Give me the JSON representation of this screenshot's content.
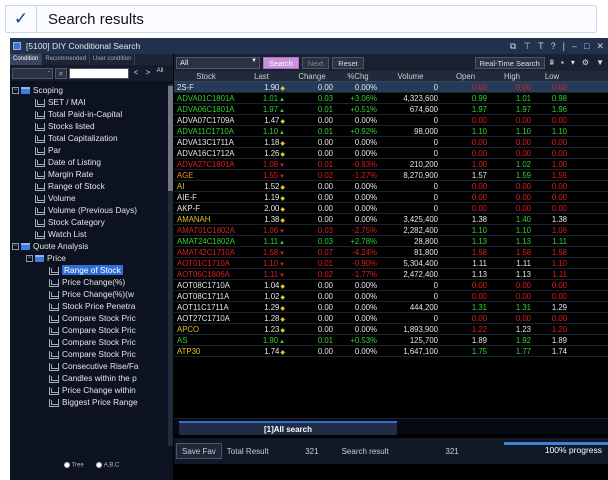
{
  "header": {
    "check": "✓",
    "title": "Search results"
  },
  "window": {
    "title": "[5100] DIY Conditional Search",
    "controls": [
      "⧉",
      "⊤",
      "T",
      "?",
      "|",
      "–",
      "□",
      "✕"
    ]
  },
  "left": {
    "tabs": [
      "Condition",
      "Recommended",
      "User condition"
    ],
    "filter_label": "-",
    "search_icon": "⌕",
    "nav_prev": "<",
    "nav_next": ">",
    "nav_all": "All",
    "tree": [
      {
        "label": "Scoping",
        "level": 0,
        "type": "folder",
        "expand": "−"
      },
      {
        "label": "SET / MAI",
        "level": 1,
        "type": "doc"
      },
      {
        "label": "Total Paid-in-Capital",
        "level": 1,
        "type": "doc"
      },
      {
        "label": "Stocks listed",
        "level": 1,
        "type": "doc"
      },
      {
        "label": "Total Capitalization",
        "level": 1,
        "type": "doc"
      },
      {
        "label": "Par",
        "level": 1,
        "type": "doc"
      },
      {
        "label": "Date of Listing",
        "level": 1,
        "type": "doc"
      },
      {
        "label": "Margin Rate",
        "level": 1,
        "type": "doc"
      },
      {
        "label": "Range of Stock",
        "level": 1,
        "type": "doc"
      },
      {
        "label": "Volume",
        "level": 1,
        "type": "doc"
      },
      {
        "label": "Volume (Previous Days)",
        "level": 1,
        "type": "doc"
      },
      {
        "label": "Stock Category",
        "level": 1,
        "type": "doc"
      },
      {
        "label": "Watch List",
        "level": 1,
        "type": "doc"
      },
      {
        "label": "Quote Analysis",
        "level": 0,
        "type": "folder",
        "expand": "−"
      },
      {
        "label": "Price",
        "level": 1,
        "type": "folder",
        "expand": "−"
      },
      {
        "label": "Range of Stock",
        "level": 2,
        "type": "doc",
        "selected": true
      },
      {
        "label": "Price Change(%)",
        "level": 2,
        "type": "doc"
      },
      {
        "label": "Price Change(%)(w",
        "level": 2,
        "type": "doc"
      },
      {
        "label": "Stock Price Penetra",
        "level": 2,
        "type": "doc"
      },
      {
        "label": "Compare Stock Pric",
        "level": 2,
        "type": "doc"
      },
      {
        "label": "Compare Stock Pric",
        "level": 2,
        "type": "doc"
      },
      {
        "label": "Compare Stock Pric",
        "level": 2,
        "type": "doc"
      },
      {
        "label": "Compare Stock Pric",
        "level": 2,
        "type": "doc"
      },
      {
        "label": "Consecutive Rise/Fa",
        "level": 2,
        "type": "doc"
      },
      {
        "label": "Candles within the p",
        "level": 2,
        "type": "doc"
      },
      {
        "label": "Price Change within",
        "level": 2,
        "type": "doc"
      },
      {
        "label": "Biggest Price Range",
        "level": 2,
        "type": "doc"
      }
    ],
    "footer": {
      "opt1": "Tree",
      "opt2": "A,B,C"
    }
  },
  "toolbar": {
    "filter": "All",
    "search": "Search",
    "next": "Next",
    "reset": "Reset",
    "realtime": "Real-Time Search",
    "icons": [
      "⩩",
      "▪",
      "▾",
      "⚙",
      "▼"
    ]
  },
  "columns": [
    "Stock",
    "Last",
    "Change",
    "%Chg",
    "Volume",
    "Open",
    "High",
    "Low"
  ],
  "colors": {
    "up": "#31d331",
    "down": "#e21e1e",
    "flat": "#e6e6e6",
    "yellow": "#e6c21e",
    "orange": "#f08a1c"
  },
  "rows": [
    {
      "sym": "2S-F",
      "last": "1.90",
      "arr": "◆",
      "chg": "0.00",
      "pct": "0.00%",
      "vol": "0",
      "open": "0.00",
      "high": "0.00",
      "low": "0.00",
      "c": "flat",
      "sc": "flat",
      "oc": "down",
      "hc": "down",
      "lc": "down"
    },
    {
      "sym": "ADVA01C1801A",
      "last": "1.01",
      "arr": "▲",
      "chg": "0.03",
      "pct": "+3.06%",
      "vol": "4,323,600",
      "open": "0.99",
      "high": "1.01",
      "low": "0.98",
      "c": "up",
      "sc": "up",
      "oc": "up",
      "hc": "up",
      "lc": "up"
    },
    {
      "sym": "ADVA06C1801A",
      "last": "1.97",
      "arr": "▲",
      "chg": "0.01",
      "pct": "+0.51%",
      "vol": "674,600",
      "open": "1.97",
      "high": "1.97",
      "low": "1.96",
      "c": "up",
      "sc": "up",
      "oc": "up",
      "hc": "up",
      "lc": "up"
    },
    {
      "sym": "ADVA07C1709A",
      "last": "1.47",
      "arr": "◆",
      "chg": "0.00",
      "pct": "0.00%",
      "vol": "0",
      "open": "0.00",
      "high": "0.00",
      "low": "0.00",
      "c": "flat",
      "sc": "flat",
      "oc": "down",
      "hc": "down",
      "lc": "down"
    },
    {
      "sym": "ADVA11C1710A",
      "last": "1.10",
      "arr": "▲",
      "chg": "0.01",
      "pct": "+0.92%",
      "vol": "98,000",
      "open": "1.10",
      "high": "1.10",
      "low": "1.10",
      "c": "up",
      "sc": "up",
      "oc": "up",
      "hc": "up",
      "lc": "up"
    },
    {
      "sym": "ADVA13C1711A",
      "last": "1.18",
      "arr": "◆",
      "chg": "0.00",
      "pct": "0.00%",
      "vol": "0",
      "open": "0.00",
      "high": "0.00",
      "low": "0.00",
      "c": "flat",
      "sc": "flat",
      "oc": "down",
      "hc": "down",
      "lc": "down"
    },
    {
      "sym": "ADVA16C1712A",
      "last": "1.26",
      "arr": "◆",
      "chg": "0.00",
      "pct": "0.00%",
      "vol": "0",
      "open": "0.00",
      "high": "0.00",
      "low": "0.00",
      "c": "flat",
      "sc": "flat",
      "oc": "down",
      "hc": "down",
      "lc": "down"
    },
    {
      "sym": "ADVA27C1801A",
      "last": "1.06",
      "arr": "▼",
      "chg": "0.01",
      "pct": "-0.93%",
      "vol": "210,200",
      "open": "1.00",
      "high": "1.02",
      "low": "1.00",
      "c": "down",
      "sc": "down",
      "oc": "down",
      "hc": "up",
      "lc": "down"
    },
    {
      "sym": "AGE",
      "last": "1.55",
      "arr": "▼",
      "chg": "0.02",
      "pct": "-1.27%",
      "vol": "8,270,900",
      "open": "1.57",
      "high": "1.59",
      "low": "1.55",
      "c": "down",
      "sc": "orange",
      "oc": "flat",
      "hc": "up",
      "lc": "down"
    },
    {
      "sym": "AI",
      "last": "1.52",
      "arr": "◆",
      "chg": "0.00",
      "pct": "0.00%",
      "vol": "0",
      "open": "0.00",
      "high": "0.00",
      "low": "0.00",
      "c": "flat",
      "sc": "yellow",
      "oc": "down",
      "hc": "down",
      "lc": "down"
    },
    {
      "sym": "AIE-F",
      "last": "1.19",
      "arr": "◆",
      "chg": "0.00",
      "pct": "0.00%",
      "vol": "0",
      "open": "0.00",
      "high": "0.00",
      "low": "0.00",
      "c": "flat",
      "sc": "flat",
      "oc": "down",
      "hc": "down",
      "lc": "down"
    },
    {
      "sym": "AKP-F",
      "last": "2.00",
      "arr": "◆",
      "chg": "0.00",
      "pct": "0.00%",
      "vol": "0",
      "open": "0.00",
      "high": "0.00",
      "low": "0.00",
      "c": "flat",
      "sc": "flat",
      "oc": "down",
      "hc": "down",
      "lc": "down"
    },
    {
      "sym": "AMANAH",
      "last": "1.38",
      "arr": "◆",
      "chg": "0.00",
      "pct": "0.00%",
      "vol": "3,425,400",
      "open": "1.38",
      "high": "1.40",
      "low": "1.38",
      "c": "flat",
      "sc": "yellow",
      "oc": "flat",
      "hc": "up",
      "lc": "flat"
    },
    {
      "sym": "AMAT01C1802A",
      "last": "1.06",
      "arr": "▼",
      "chg": "0.03",
      "pct": "-2.75%",
      "vol": "2,282,400",
      "open": "1.10",
      "high": "1.10",
      "low": "1.06",
      "c": "down",
      "sc": "down",
      "oc": "up",
      "hc": "up",
      "lc": "down"
    },
    {
      "sym": "AMAT24C1802A",
      "last": "1.11",
      "arr": "▲",
      "chg": "0.03",
      "pct": "+2.78%",
      "vol": "28,800",
      "open": "1.13",
      "high": "1.13",
      "low": "1.11",
      "c": "up",
      "sc": "up",
      "oc": "up",
      "hc": "up",
      "lc": "up"
    },
    {
      "sym": "AMAT42C1710A",
      "last": "1.58",
      "arr": "▼",
      "chg": "0.07",
      "pct": "-4.24%",
      "vol": "81,800",
      "open": "1.58",
      "high": "1.58",
      "low": "1.58",
      "c": "down",
      "sc": "down",
      "oc": "down",
      "hc": "down",
      "lc": "down"
    },
    {
      "sym": "AOT01C1710A",
      "last": "1.10",
      "arr": "▼",
      "chg": "0.01",
      "pct": "-0.90%",
      "vol": "5,304,400",
      "open": "1.11",
      "high": "1.11",
      "low": "1.10",
      "c": "down",
      "sc": "down",
      "oc": "flat",
      "hc": "flat",
      "lc": "down"
    },
    {
      "sym": "AOT06C1806A",
      "last": "1.11",
      "arr": "▼",
      "chg": "0.02",
      "pct": "-1.77%",
      "vol": "2,472,400",
      "open": "1.13",
      "high": "1.13",
      "low": "1.11",
      "c": "down",
      "sc": "down",
      "oc": "flat",
      "hc": "flat",
      "lc": "down"
    },
    {
      "sym": "AOT08C1710A",
      "last": "1.04",
      "arr": "◆",
      "chg": "0.00",
      "pct": "0.00%",
      "vol": "0",
      "open": "0.00",
      "high": "0.00",
      "low": "0.00",
      "c": "flat",
      "sc": "flat",
      "oc": "down",
      "hc": "down",
      "lc": "down"
    },
    {
      "sym": "AOT08C1711A",
      "last": "1.02",
      "arr": "◆",
      "chg": "0.00",
      "pct": "0.00%",
      "vol": "0",
      "open": "0.00",
      "high": "0.00",
      "low": "0.00",
      "c": "flat",
      "sc": "flat",
      "oc": "down",
      "hc": "down",
      "lc": "down"
    },
    {
      "sym": "AOT11C1711A",
      "last": "1.29",
      "arr": "◆",
      "chg": "0.00",
      "pct": "0.00%",
      "vol": "444,200",
      "open": "1.31",
      "high": "1.31",
      "low": "1.29",
      "c": "flat",
      "sc": "flat",
      "oc": "up",
      "hc": "up",
      "lc": "flat"
    },
    {
      "sym": "AOT27C1710A",
      "last": "1.28",
      "arr": "◆",
      "chg": "0.00",
      "pct": "0.00%",
      "vol": "0",
      "open": "0.00",
      "high": "0.00",
      "low": "0.00",
      "c": "flat",
      "sc": "flat",
      "oc": "down",
      "hc": "down",
      "lc": "down"
    },
    {
      "sym": "APCO",
      "last": "1.23",
      "arr": "◆",
      "chg": "0.00",
      "pct": "0.00%",
      "vol": "1,893,900",
      "open": "1.22",
      "high": "1.23",
      "low": "1.20",
      "c": "flat",
      "sc": "yellow",
      "oc": "down",
      "hc": "flat",
      "lc": "down"
    },
    {
      "sym": "AS",
      "last": "1.90",
      "arr": "▲",
      "chg": "0.01",
      "pct": "+0.53%",
      "vol": "125,700",
      "open": "1.89",
      "high": "1.92",
      "low": "1.89",
      "c": "up",
      "sc": "up",
      "oc": "flat",
      "hc": "up",
      "lc": "flat"
    },
    {
      "sym": "ATP30",
      "last": "1.74",
      "arr": "◆",
      "chg": "0.00",
      "pct": "0.00%",
      "vol": "1,647,100",
      "open": "1.75",
      "high": "1.77",
      "low": "1.74",
      "c": "flat",
      "sc": "yellow",
      "oc": "up",
      "hc": "up",
      "lc": "flat"
    }
  ],
  "bottom_tab": "[1]All search",
  "status": {
    "save": "Save Fav",
    "total_label": "Total Result",
    "total": "321",
    "search_label": "Search result",
    "search": "321",
    "progress_text": "100% progress",
    "progress": 1.0
  }
}
